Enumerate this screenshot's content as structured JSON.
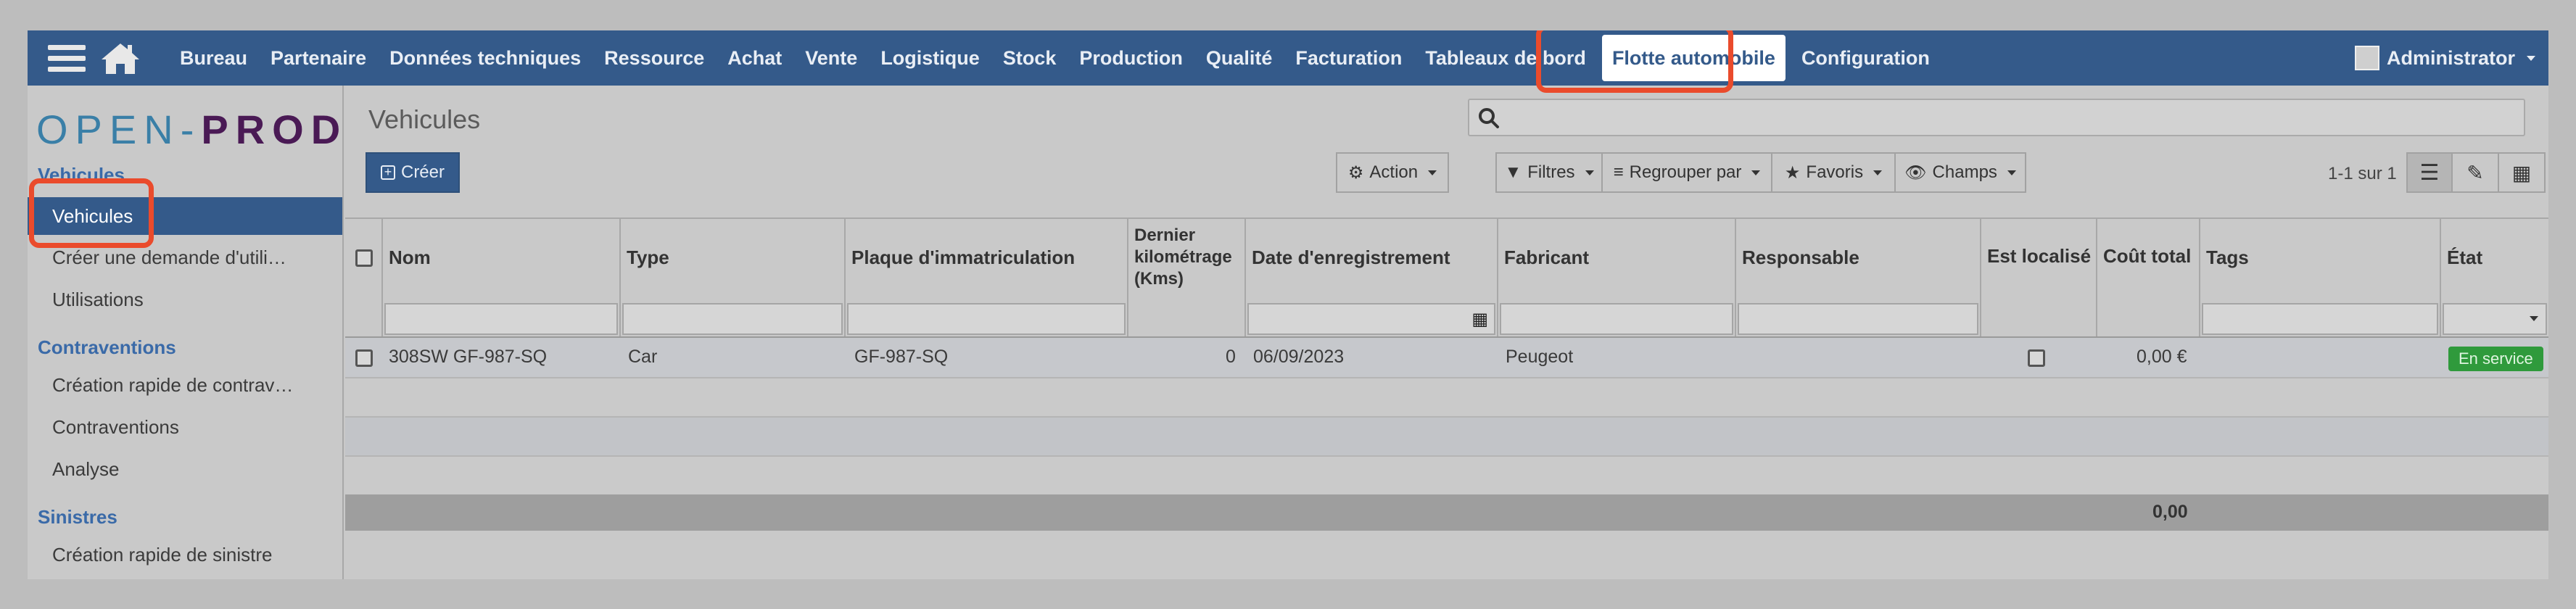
{
  "navbar": {
    "menu": [
      "Bureau",
      "Partenaire",
      "Données techniques",
      "Ressource",
      "Achat",
      "Vente",
      "Logistique",
      "Stock",
      "Production",
      "Qualité",
      "Facturation",
      "Tableaux de bord",
      "Flotte automobile",
      "Configuration"
    ],
    "active": "Flotte automobile",
    "user": "Administrator",
    "icons": [
      "hamburger-icon",
      "home-icon"
    ]
  },
  "logo": {
    "part1": "OPEN",
    "dash": "-",
    "part2": "PROD"
  },
  "sidebar": {
    "section_vehicules": "Vehicules",
    "items_vehicules": [
      "Vehicules",
      "Créer une demande d'utili…",
      "Utilisations"
    ],
    "section_contraventions": "Contraventions",
    "items_contraventions": [
      "Création rapide de contrav…",
      "Contraventions",
      "Analyse"
    ],
    "section_sinistres": "Sinistres",
    "items_sinistres": [
      "Création rapide de sinistre"
    ]
  },
  "main": {
    "title": "Vehicules",
    "create_label": "Créer",
    "action_label": "Action",
    "filters_label": "Filtres",
    "group_label": "Regrouper par",
    "favorites_label": "Favoris",
    "fields_label": "Champs",
    "pager": "1-1 sur 1"
  },
  "table": {
    "columns": [
      "Nom",
      "Type",
      "Plaque d'immatriculation",
      "Dernier kilométrage (Kms)",
      "Date d'enregistrement",
      "Fabricant",
      "Responsable",
      "Est localisé",
      "Coût total",
      "Tags",
      "État"
    ],
    "rows": [
      {
        "nom": "308SW GF-987-SQ",
        "type": "Car",
        "plaque": "GF-987-SQ",
        "km": "0",
        "date": "06/09/2023",
        "fabricant": "Peugeot",
        "responsable": "",
        "cout": "0,00 €",
        "tags": "",
        "etat": "En service"
      }
    ],
    "total_cout": "0,00"
  },
  "colors": {
    "navbar": "#345a8a",
    "highlight": "#ea4b2c",
    "badge": "#2f9a3c"
  }
}
